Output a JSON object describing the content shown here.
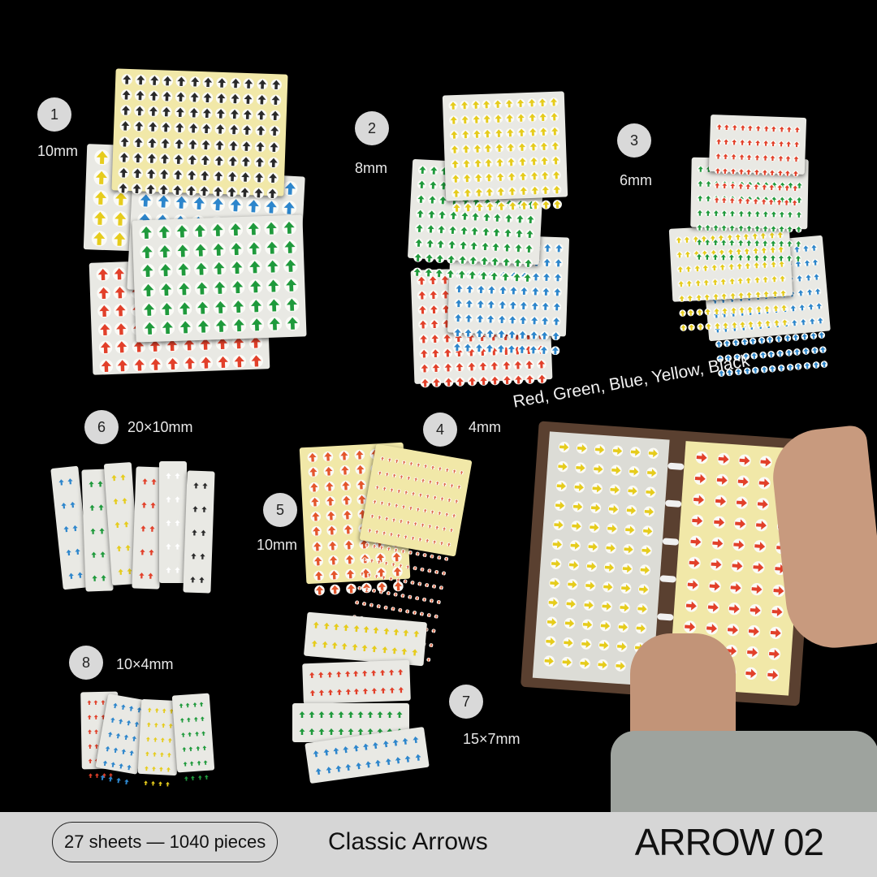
{
  "groups": [
    {
      "number": "1",
      "size": "10mm"
    },
    {
      "number": "2",
      "size": "8mm"
    },
    {
      "number": "3",
      "size": "6mm"
    },
    {
      "number": "4",
      "size": "4mm"
    },
    {
      "number": "5",
      "size": "10mm"
    },
    {
      "number": "6",
      "size": "20×10mm"
    },
    {
      "number": "7",
      "size": "15×7mm"
    },
    {
      "number": "8",
      "size": "10×4mm"
    }
  ],
  "colors_caption": "Red, Green, Blue, Yellow, Black",
  "footer": {
    "count": "27 sheets — 1040 pieces",
    "name": "Classic Arrows",
    "code": "ARROW 02"
  },
  "palette": {
    "red": "#e2402a",
    "green": "#1f9a3c",
    "blue": "#2d86cc",
    "yellow": "#e6cc1c",
    "black": "#2a2a2a",
    "sheet": "#e9e9e4",
    "cream": "#f1e8a8"
  }
}
